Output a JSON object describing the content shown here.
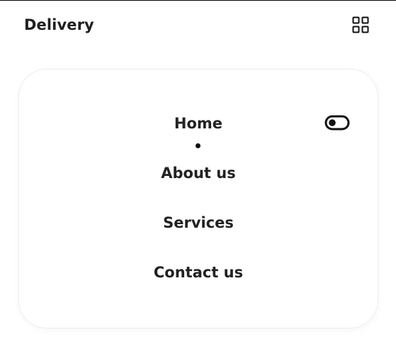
{
  "header": {
    "logo_text": "Delivery",
    "menu_icon": "grid-menu-icon"
  },
  "nav": {
    "items": [
      {
        "label": "Home",
        "active": true
      },
      {
        "label": "About us",
        "active": false
      },
      {
        "label": "Services",
        "active": false
      },
      {
        "label": "Contact us",
        "active": false
      }
    ],
    "theme_toggle_icon": "toggle-switch-icon"
  },
  "colors": {
    "text": "#222222",
    "background": "#ffffff",
    "card_border": "#eeeeee"
  }
}
